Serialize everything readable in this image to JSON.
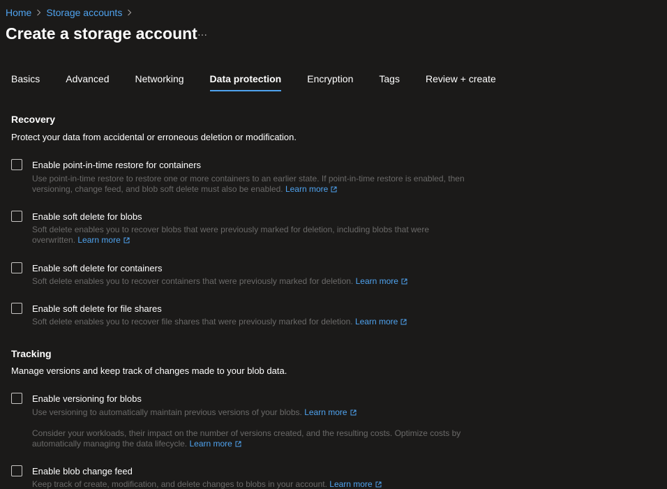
{
  "breadcrumb": {
    "items": [
      "Home",
      "Storage accounts"
    ],
    "separator": ">"
  },
  "page": {
    "title": "Create a storage account",
    "more_label": "···"
  },
  "tabs": [
    {
      "label": "Basics",
      "active": false
    },
    {
      "label": "Advanced",
      "active": false
    },
    {
      "label": "Networking",
      "active": false
    },
    {
      "label": "Data protection",
      "active": true
    },
    {
      "label": "Encryption",
      "active": false
    },
    {
      "label": "Tags",
      "active": false
    },
    {
      "label": "Review + create",
      "active": false
    }
  ],
  "recovery": {
    "heading": "Recovery",
    "description": "Protect your data from accidental or erroneous deletion or modification.",
    "options": [
      {
        "label": "Enable point-in-time restore for containers",
        "checked": false,
        "help": "Use point-in-time restore to restore one or more containers to an earlier state. If point-in-time restore is enabled, then versioning, change feed, and blob soft delete must also be enabled.",
        "link": "Learn more"
      },
      {
        "label": "Enable soft delete for blobs",
        "checked": false,
        "help": "Soft delete enables you to recover blobs that were previously marked for deletion, including blobs that were overwritten.",
        "link": "Learn more"
      },
      {
        "label": "Enable soft delete for containers",
        "checked": false,
        "help": "Soft delete enables you to recover containers that were previously marked for deletion.",
        "link": "Learn more"
      },
      {
        "label": "Enable soft delete for file shares",
        "checked": false,
        "help": "Soft delete enables you to recover file shares that were previously marked for deletion.",
        "link": "Learn more"
      }
    ]
  },
  "tracking": {
    "heading": "Tracking",
    "description": "Manage versions and keep track of changes made to your blob data.",
    "versioning": {
      "label": "Enable versioning for blobs",
      "checked": false,
      "help": "Use versioning to automatically maintain previous versions of your blobs.",
      "link": "Learn more",
      "note": "Consider your workloads, their impact on the number of versions created, and the resulting costs. Optimize costs by automatically managing the data lifecycle.",
      "note_link": "Learn more"
    },
    "change_feed": {
      "label": "Enable blob change feed",
      "checked": false,
      "help": "Keep track of create, modification, and delete changes to blobs in your account.",
      "link": "Learn more"
    }
  },
  "icons": {
    "breadcrumb_separator": "chevron-right-icon",
    "external_link": "open-in-new-window-icon"
  },
  "colors": {
    "background": "#1b1a19",
    "link": "#4fa3ef",
    "help_text": "#6b6a69",
    "tab_underline": "#4fa3ef",
    "checkbox_border": "#c8c6c4"
  }
}
